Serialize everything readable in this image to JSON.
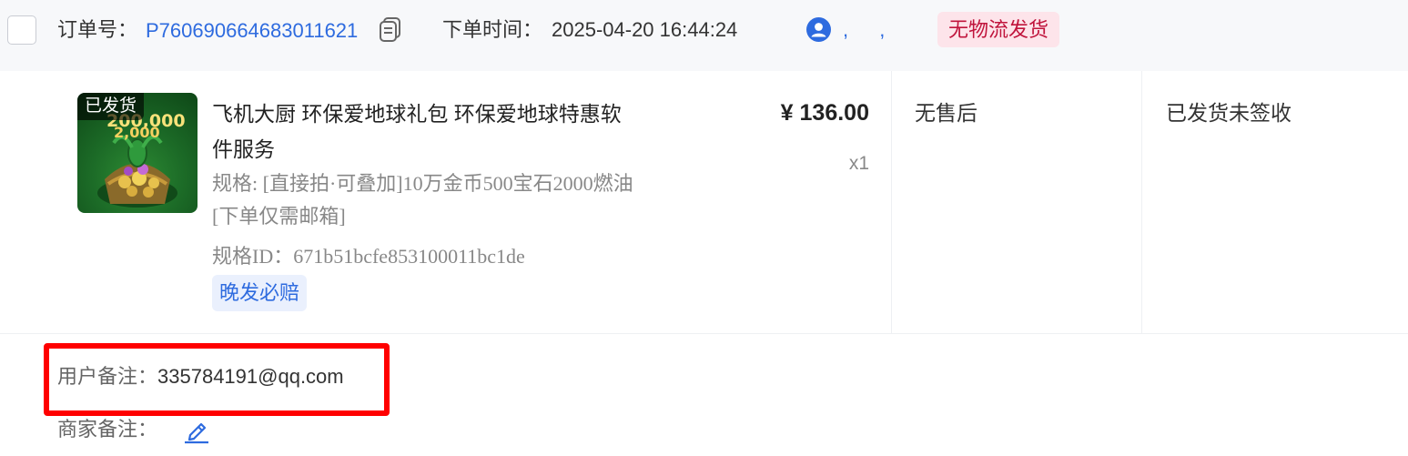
{
  "order": {
    "order_no_label": "订单号：",
    "order_no": "P760690664683011621",
    "time_label": "下单时间：",
    "time_value": "2025-04-20 16:44:24",
    "buyer_text": ", ,",
    "logistics_tag": "无物流发货"
  },
  "product": {
    "thumb_badge": "已发货",
    "thumb_num1": "200,000",
    "thumb_num2": "2,000",
    "title": "飞机大厨 环保爱地球礼包 环保爱地球特惠软件服务",
    "spec": "规格: [直接拍·可叠加]10万金币500宝石2000燃油[下单仅需邮箱]",
    "spec_id": "规格ID：671b51bcfe853100011bc1de",
    "service_tag": "晚发必赔",
    "price": "¥ 136.00",
    "qty": "x1",
    "aftersale": "无售后",
    "ship_status": "已发货未签收"
  },
  "notes": {
    "user_label": "用户备注：",
    "user_value": "335784191@qq.com",
    "merchant_label": "商家备注："
  },
  "colors": {
    "accent": "#2e6bdf",
    "tag_pink_bg": "#fde4ea",
    "tag_pink_text": "#c0143c",
    "highlight": "#ff0000"
  },
  "icons": [
    "copy-icon",
    "user-avatar-icon",
    "edit-icon"
  ]
}
